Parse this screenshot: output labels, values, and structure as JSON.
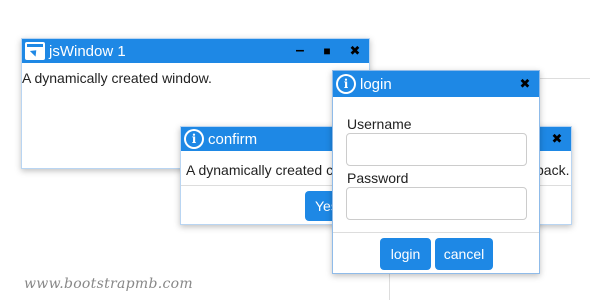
{
  "window1": {
    "title": "jsWindow 1",
    "body": "A dynamically created window.",
    "icon": "app-window-icon",
    "controls": {
      "minimize": "–",
      "maximize": "■",
      "close": "✖"
    }
  },
  "confirm": {
    "title": "confirm",
    "body_left": "A dynamically created co",
    "body_right": "back.",
    "yes_label": "Yes",
    "close": "✖",
    "icon": "info-icon"
  },
  "window_right": {
    "close": "✖"
  },
  "login": {
    "title": "login",
    "icon": "info-icon",
    "close": "✖",
    "username_label": "Username",
    "username_value": "",
    "password_label": "Password",
    "password_value": "",
    "login_button": "login",
    "cancel_button": "cancel"
  },
  "watermark": "www.bootstrapmb.com",
  "colors": {
    "titlebar": "#1e88e5",
    "button": "#1e88e5",
    "border": "#b9d5f2"
  }
}
